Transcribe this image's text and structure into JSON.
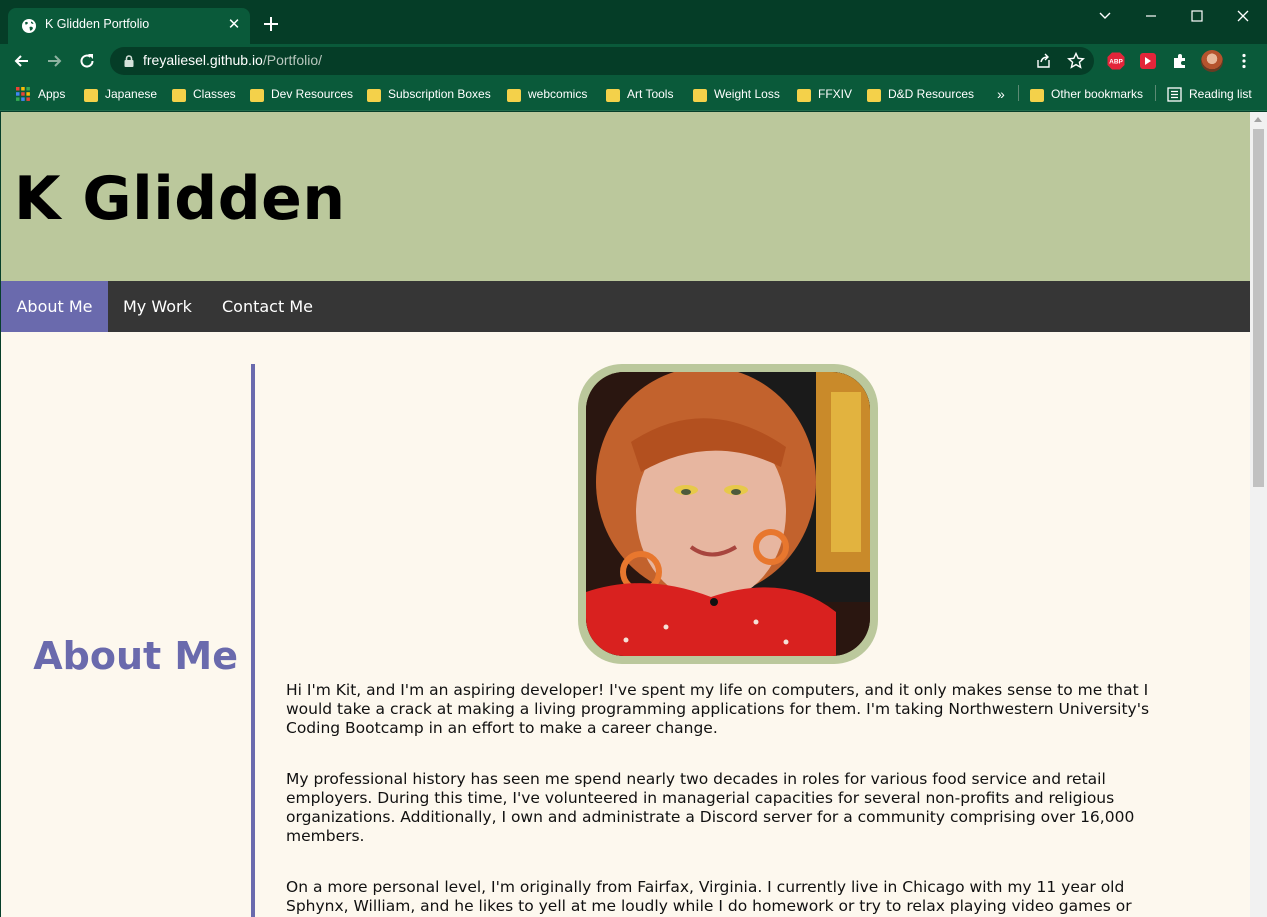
{
  "browser": {
    "tab_title": "K Glidden Portfolio",
    "url_host": "freyaliesel.github.io",
    "url_path": "/Portfolio/",
    "bookmarks": [
      "Apps",
      "Japanese",
      "Classes",
      "Dev Resources",
      "Subscription Boxes",
      "webcomics",
      "Art Tools",
      "Weight Loss",
      "FFXIV",
      "D&D Resources"
    ],
    "other_bookmarks": "Other bookmarks",
    "reading_list": "Reading list",
    "overflow_label": "»",
    "ext_abp_label": "ABP"
  },
  "site": {
    "title": "K Glidden",
    "nav": [
      "About Me",
      "My Work",
      "Contact Me"
    ],
    "active_nav": "About Me",
    "section_heading": "About Me",
    "bio_paragraphs": [
      "Hi I'm Kit, and I'm an aspiring developer! I've spent my life on computers, and it only makes sense to me that I would take a crack at making a living programming applications for them. I'm taking Northwestern University's Coding Bootcamp in an effort to make a career change.",
      "My professional history has seen me spend nearly two decades in roles for various food service and retail employers. During this time, I've volunteered in managerial capacities for several non-profits and religious organizations. Additionally, I own and administrate a Discord server for a community comprising over 16,000 members.",
      "On a more personal level, I'm originally from Fairfax, Virginia. I currently live in Chicago with my 11 year old Sphynx, William, and he likes to yell at me loudly while I do homework or try to relax playing video games or"
    ]
  },
  "colors": {
    "header_bg": "#bbc89c",
    "nav_bg": "#363636",
    "accent": "#6a6aad",
    "page_bg": "#fdf8ee",
    "chrome_bg": "#0a5a3a"
  }
}
